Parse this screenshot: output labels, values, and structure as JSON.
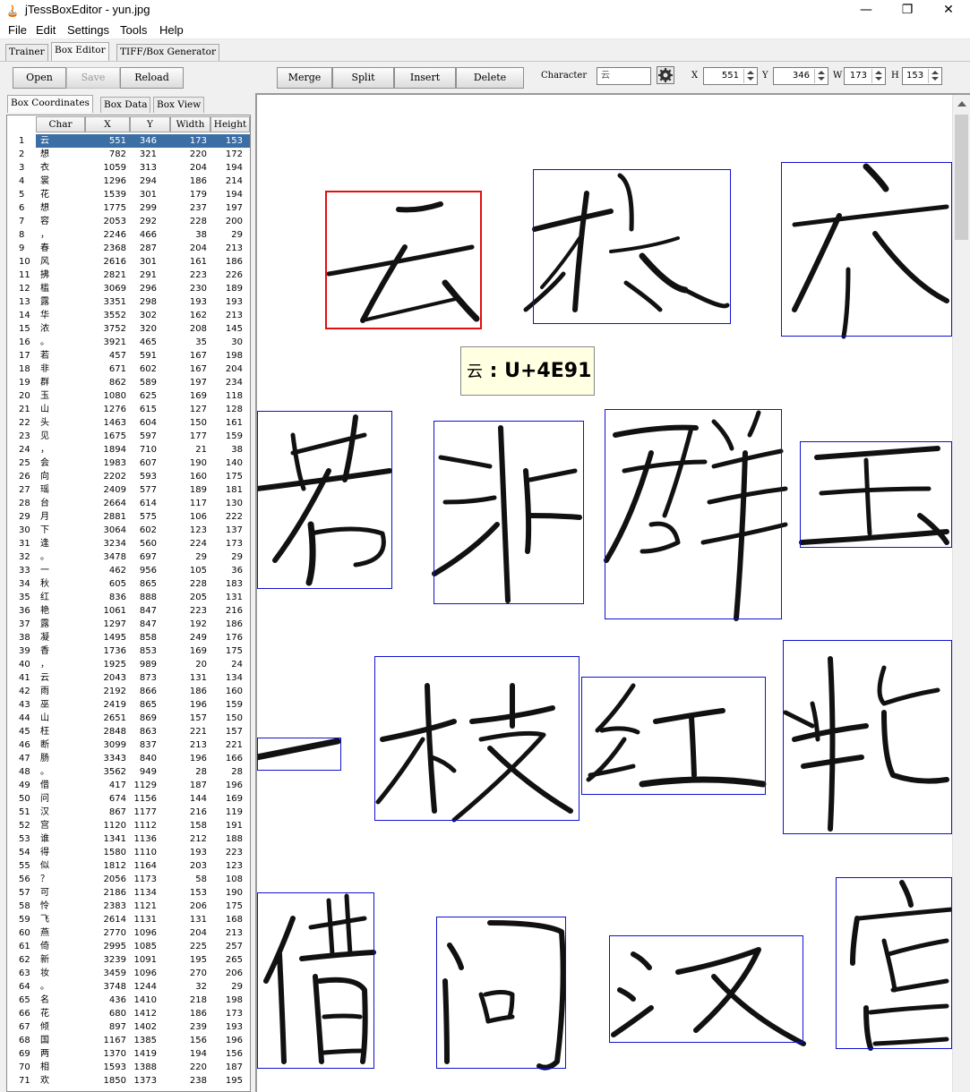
{
  "window": {
    "title": "jTessBoxEditor - yun.jpg",
    "controls": {
      "minimize": "—",
      "maximize": "❐",
      "close": "✕"
    }
  },
  "menu": [
    "File",
    "Edit",
    "Settings",
    "Tools",
    "Help"
  ],
  "main_tabs": [
    "Trainer",
    "Box Editor",
    "TIFF/Box Generator"
  ],
  "toolbar": {
    "open": "Open",
    "save": "Save",
    "reload": "Reload",
    "merge": "Merge",
    "split": "Split",
    "insert": "Insert",
    "delete": "Delete",
    "character_label": "Character",
    "character_value": "云",
    "x_label": "X",
    "x_value": "551",
    "y_label": "Y",
    "y_value": "346",
    "w_label": "W",
    "w_value": "173",
    "h_label": "H",
    "h_value": "153"
  },
  "left_tabs": [
    "Box Coordinates",
    "Box Data",
    "Box View"
  ],
  "table": {
    "headers": [
      "Char",
      "X",
      "Y",
      "Width",
      "Height"
    ],
    "selected_row": 1,
    "rows": [
      [
        "1",
        "云",
        "551",
        "346",
        "173",
        "153"
      ],
      [
        "2",
        "想",
        "782",
        "321",
        "220",
        "172"
      ],
      [
        "3",
        "衣",
        "1059",
        "313",
        "204",
        "194"
      ],
      [
        "4",
        "裳",
        "1296",
        "294",
        "186",
        "214"
      ],
      [
        "5",
        "花",
        "1539",
        "301",
        "179",
        "194"
      ],
      [
        "6",
        "想",
        "1775",
        "299",
        "237",
        "197"
      ],
      [
        "7",
        "容",
        "2053",
        "292",
        "228",
        "200"
      ],
      [
        "8",
        "，",
        "2246",
        "466",
        "38",
        "29"
      ],
      [
        "9",
        "春",
        "2368",
        "287",
        "204",
        "213"
      ],
      [
        "10",
        "风",
        "2616",
        "301",
        "161",
        "186"
      ],
      [
        "11",
        "拂",
        "2821",
        "291",
        "223",
        "226"
      ],
      [
        "12",
        "槛",
        "3069",
        "296",
        "230",
        "189"
      ],
      [
        "13",
        "露",
        "3351",
        "298",
        "193",
        "193"
      ],
      [
        "14",
        "华",
        "3552",
        "302",
        "162",
        "213"
      ],
      [
        "15",
        "浓",
        "3752",
        "320",
        "208",
        "145"
      ],
      [
        "16",
        "。",
        "3921",
        "465",
        "35",
        "30"
      ],
      [
        "17",
        "若",
        "457",
        "591",
        "167",
        "198"
      ],
      [
        "18",
        "非",
        "671",
        "602",
        "167",
        "204"
      ],
      [
        "19",
        "群",
        "862",
        "589",
        "197",
        "234"
      ],
      [
        "20",
        "玉",
        "1080",
        "625",
        "169",
        "118"
      ],
      [
        "21",
        "山",
        "1276",
        "615",
        "127",
        "128"
      ],
      [
        "22",
        "头",
        "1463",
        "604",
        "150",
        "161"
      ],
      [
        "23",
        "见",
        "1675",
        "597",
        "177",
        "159"
      ],
      [
        "24",
        "，",
        "1894",
        "710",
        "21",
        "38"
      ],
      [
        "25",
        "会",
        "1983",
        "607",
        "190",
        "140"
      ],
      [
        "26",
        "向",
        "2202",
        "593",
        "160",
        "175"
      ],
      [
        "27",
        "瑶",
        "2409",
        "577",
        "189",
        "181"
      ],
      [
        "28",
        "台",
        "2664",
        "614",
        "117",
        "130"
      ],
      [
        "29",
        "月",
        "2881",
        "575",
        "106",
        "222"
      ],
      [
        "30",
        "下",
        "3064",
        "602",
        "123",
        "137"
      ],
      [
        "31",
        "逢",
        "3234",
        "560",
        "224",
        "173"
      ],
      [
        "32",
        "。",
        "3478",
        "697",
        "29",
        "29"
      ],
      [
        "33",
        "一",
        "462",
        "956",
        "105",
        "36"
      ],
      [
        "34",
        "秋",
        "605",
        "865",
        "228",
        "183"
      ],
      [
        "35",
        "红",
        "836",
        "888",
        "205",
        "131"
      ],
      [
        "36",
        "艳",
        "1061",
        "847",
        "223",
        "216"
      ],
      [
        "37",
        "露",
        "1297",
        "847",
        "192",
        "186"
      ],
      [
        "38",
        "凝",
        "1495",
        "858",
        "249",
        "176"
      ],
      [
        "39",
        "香",
        "1736",
        "853",
        "169",
        "175"
      ],
      [
        "40",
        "，",
        "1925",
        "989",
        "20",
        "24"
      ],
      [
        "41",
        "云",
        "2043",
        "873",
        "131",
        "134"
      ],
      [
        "42",
        "雨",
        "2192",
        "866",
        "186",
        "160"
      ],
      [
        "43",
        "巫",
        "2419",
        "865",
        "196",
        "159"
      ],
      [
        "44",
        "山",
        "2651",
        "869",
        "157",
        "150"
      ],
      [
        "45",
        "枉",
        "2848",
        "863",
        "221",
        "157"
      ],
      [
        "46",
        "断",
        "3099",
        "837",
        "213",
        "221"
      ],
      [
        "47",
        "肠",
        "3343",
        "840",
        "196",
        "166"
      ],
      [
        "48",
        "。",
        "3562",
        "949",
        "28",
        "28"
      ],
      [
        "49",
        "借",
        "417",
        "1129",
        "187",
        "196"
      ],
      [
        "50",
        "问",
        "674",
        "1156",
        "144",
        "169"
      ],
      [
        "51",
        "汉",
        "867",
        "1177",
        "216",
        "119"
      ],
      [
        "52",
        "宫",
        "1120",
        "1112",
        "158",
        "191"
      ],
      [
        "53",
        "谁",
        "1341",
        "1136",
        "212",
        "188"
      ],
      [
        "54",
        "得",
        "1580",
        "1110",
        "193",
        "223"
      ],
      [
        "55",
        "似",
        "1812",
        "1164",
        "203",
        "123"
      ],
      [
        "56",
        "？",
        "2056",
        "1173",
        "58",
        "108"
      ],
      [
        "57",
        "可",
        "2186",
        "1134",
        "153",
        "190"
      ],
      [
        "58",
        "怜",
        "2383",
        "1121",
        "206",
        "175"
      ],
      [
        "59",
        "飞",
        "2614",
        "1131",
        "131",
        "168"
      ],
      [
        "60",
        "燕",
        "2770",
        "1096",
        "204",
        "213"
      ],
      [
        "61",
        "倚",
        "2995",
        "1085",
        "225",
        "257"
      ],
      [
        "62",
        "新",
        "3239",
        "1091",
        "195",
        "265"
      ],
      [
        "63",
        "妆",
        "3459",
        "1096",
        "270",
        "206"
      ],
      [
        "64",
        "。",
        "3748",
        "1244",
        "32",
        "29"
      ],
      [
        "65",
        "名",
        "436",
        "1410",
        "218",
        "198"
      ],
      [
        "66",
        "花",
        "680",
        "1412",
        "186",
        "173"
      ],
      [
        "67",
        "倾",
        "897",
        "1402",
        "239",
        "193"
      ],
      [
        "68",
        "国",
        "1167",
        "1385",
        "156",
        "196"
      ],
      [
        "69",
        "两",
        "1370",
        "1419",
        "194",
        "156"
      ],
      [
        "70",
        "相",
        "1593",
        "1388",
        "220",
        "187"
      ],
      [
        "71",
        "欢",
        "1850",
        "1373",
        "238",
        "195"
      ]
    ]
  },
  "tooltip": {
    "char": "云",
    "code": "U+4E91"
  },
  "colors": {
    "selected_row": "#3a6ea5",
    "box_border": "#1010d0",
    "selected_box_border": "#e01010",
    "tooltip_bg": "#ffffe1"
  }
}
